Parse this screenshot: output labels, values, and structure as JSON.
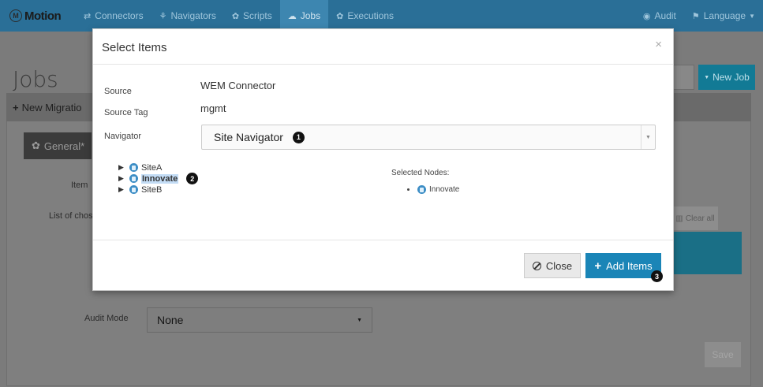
{
  "navbar": {
    "brand": "Motion",
    "items": [
      {
        "label": "Connectors",
        "icon": "shuffle-icon"
      },
      {
        "label": "Navigators",
        "icon": "sitemap-icon"
      },
      {
        "label": "Scripts",
        "icon": "gear-icon"
      },
      {
        "label": "Jobs",
        "icon": "cloud-icon",
        "active": true
      },
      {
        "label": "Executions",
        "icon": "gear-icon"
      }
    ],
    "audit": "Audit",
    "language": "Language"
  },
  "page": {
    "title": "Jobs",
    "new_job_button": "New Job",
    "panel_title": "New Migratio",
    "general_tab": "General*",
    "item_label": "Item",
    "list_label": "List of chos",
    "clear_all": "Clear all",
    "audit_mode_label": "Audit Mode",
    "audit_mode_value": "None",
    "save": "Save"
  },
  "modal": {
    "title": "Select Items",
    "close_symbol": "×",
    "source_label": "Source",
    "source_value": "WEM Connector",
    "source_tag_label": "Source Tag",
    "source_tag_value": "mgmt",
    "navigator_label": "Navigator",
    "navigator_value": "Site Navigator",
    "tree": [
      {
        "label": "SiteA",
        "selected": false
      },
      {
        "label": "Innovate",
        "selected": true
      },
      {
        "label": "SiteB",
        "selected": false
      }
    ],
    "selected_nodes_title": "Selected Nodes:",
    "selected_nodes": [
      "Innovate"
    ],
    "close_button": "Close",
    "add_button": "Add Items"
  },
  "annotations": {
    "step1": "1",
    "step2": "2",
    "step3": "3"
  },
  "colors": {
    "navbar": "#2a6f97",
    "primary": "#1a85b7",
    "badge": "#111111"
  }
}
